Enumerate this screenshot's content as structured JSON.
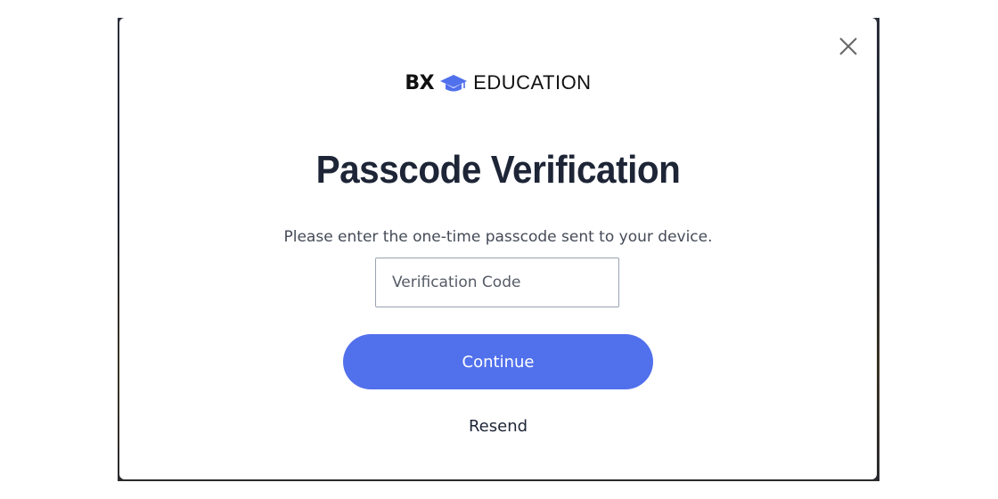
{
  "brand": {
    "prefix": "BX",
    "name": "EDUCATION",
    "icon": "graduation-cap-icon",
    "accent_color": "#5170ec"
  },
  "modal": {
    "close_icon": "close-icon",
    "title": "Passcode Verification",
    "subtitle": "Please enter the one-time passcode sent to your device.",
    "code_field": {
      "placeholder": "Verification Code",
      "value": ""
    },
    "continue_label": "Continue",
    "resend_label": "Resend"
  },
  "colors": {
    "primary_button": "#5170ec",
    "title_text": "#1d2536"
  }
}
